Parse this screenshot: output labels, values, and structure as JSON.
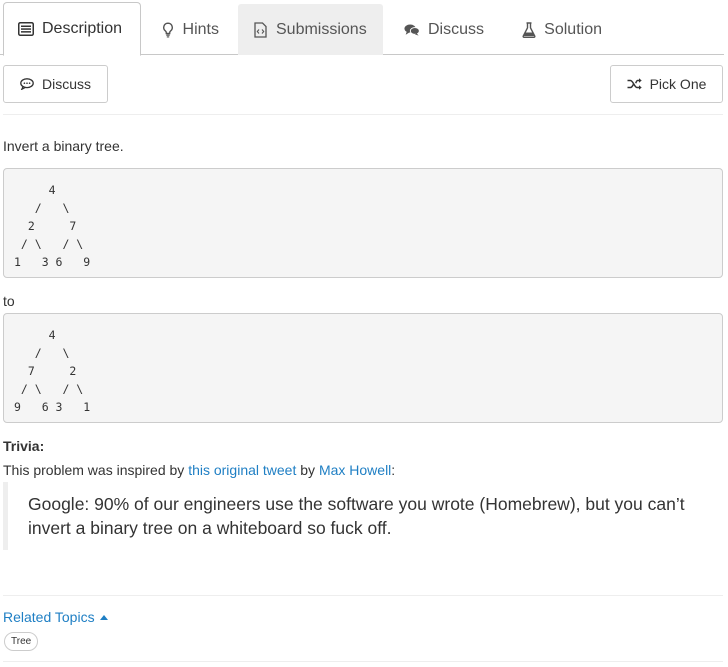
{
  "tabs": [
    {
      "label": "Description",
      "icon": "description-icon",
      "active": true
    },
    {
      "label": "Hints",
      "icon": "lightbulb-icon"
    },
    {
      "label": "Submissions",
      "icon": "code-file-icon"
    },
    {
      "label": "Discuss",
      "icon": "comments-icon"
    },
    {
      "label": "Solution",
      "icon": "flask-icon"
    }
  ],
  "toolbar": {
    "discuss_label": "Discuss",
    "pick_one_label": "Pick One"
  },
  "problem": {
    "statement": "Invert a binary tree.",
    "input_tree": "     4\n   /   \\\n  2     7\n / \\   / \\\n1   3 6   9",
    "between": "to",
    "output_tree": "     4\n   /   \\\n  7     2\n / \\   / \\\n9   6 3   1"
  },
  "trivia": {
    "heading": "Trivia:",
    "prefix": "This problem was inspired by ",
    "tweet_link": "this original tweet",
    "by": " by ",
    "author_link": "Max Howell",
    "suffix": ":",
    "quote": "Google: 90% of our engineers use the software you wrote (Homebrew), but you can’t invert a binary tree on a whiteboard so fuck off."
  },
  "related": {
    "label": "Related Topics",
    "tags": [
      "Tree"
    ]
  },
  "colors": {
    "link": "#1f7fc4",
    "code_bg": "#f5f5f5",
    "border": "#cccccc"
  }
}
